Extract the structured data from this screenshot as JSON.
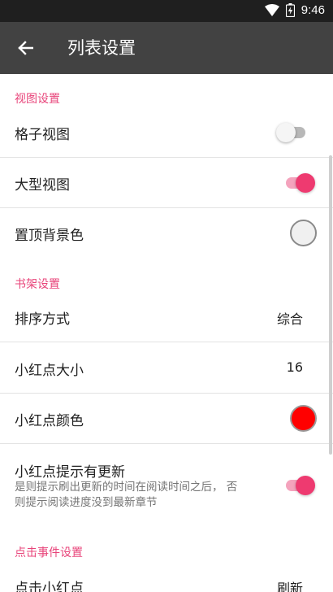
{
  "status_bar": {
    "time": "9:46",
    "icons": [
      "wifi-icon",
      "battery-charging-icon"
    ]
  },
  "app_bar": {
    "back_icon": "arrow-left-icon",
    "title": "列表设置"
  },
  "sections": {
    "view": {
      "header": "视图设置",
      "grid_view": {
        "label": "格子视图",
        "enabled": false
      },
      "large_view": {
        "label": "大型视图",
        "enabled": true
      },
      "pin_bg_color": {
        "label": "置顶背景色",
        "color": "#f0f0f0"
      }
    },
    "shelf": {
      "header": "书架设置",
      "sort": {
        "label": "排序方式",
        "value": "综合"
      },
      "dot_size": {
        "label": "小红点大小",
        "value": "16"
      },
      "dot_color": {
        "label": "小红点颜色",
        "color": "#ff0000"
      },
      "dot_update": {
        "label": "小红点提示有更新",
        "summary": "是则提示刷出更新的时间在阅读时间之后， 否则提示阅读进度没到最新章节",
        "enabled": true
      }
    },
    "click": {
      "header": "点击事件设置",
      "click_dot": {
        "label": "点击小红点",
        "value": "刷新"
      }
    }
  },
  "colors": {
    "accent": "#ee3a70",
    "section_header": "#e8447a",
    "app_bar": "#424242",
    "status_bar": "#1f1f1f"
  }
}
